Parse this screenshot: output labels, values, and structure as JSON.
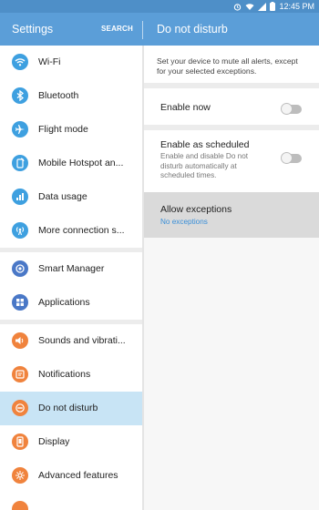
{
  "status_bar": {
    "time": "12:45 PM"
  },
  "app_bar": {
    "left_title": "Settings",
    "search_label": "SEARCH",
    "right_title": "Do not disturb"
  },
  "sidebar": {
    "groups": [
      [
        {
          "label": "Wi-Fi",
          "icon": "wifi-icon",
          "color": "#3ea0e0"
        },
        {
          "label": "Bluetooth",
          "icon": "bluetooth-icon",
          "color": "#3ea0e0"
        },
        {
          "label": "Flight mode",
          "icon": "airplane-icon",
          "color": "#3ea0e0"
        },
        {
          "label": "Mobile Hotspot an...",
          "icon": "hotspot-icon",
          "color": "#3ea0e0"
        },
        {
          "label": "Data usage",
          "icon": "data-usage-icon",
          "color": "#3ea0e0"
        },
        {
          "label": "More connection s...",
          "icon": "more-connections-icon",
          "color": "#3ea0e0"
        }
      ],
      [
        {
          "label": "Smart Manager",
          "icon": "smart-manager-icon",
          "color": "#4a78c7"
        },
        {
          "label": "Applications",
          "icon": "applications-icon",
          "color": "#4a78c7"
        }
      ],
      [
        {
          "label": "Sounds and vibrati...",
          "icon": "sound-icon",
          "color": "#f0833d"
        },
        {
          "label": "Notifications",
          "icon": "notifications-icon",
          "color": "#f0833d"
        },
        {
          "label": "Do not disturb",
          "icon": "do-not-disturb-icon",
          "color": "#f0833d",
          "selected": true
        },
        {
          "label": "Display",
          "icon": "display-icon",
          "color": "#f0833d"
        },
        {
          "label": "Advanced features",
          "icon": "advanced-features-icon",
          "color": "#f0833d"
        }
      ]
    ]
  },
  "detail": {
    "description": "Set your device to mute all alerts, except for your selected exceptions.",
    "enable_now": {
      "label": "Enable now",
      "state": "off"
    },
    "enable_scheduled": {
      "label": "Enable as scheduled",
      "sub": "Enable and disable Do not disturb automatically at scheduled times.",
      "state": "off"
    },
    "exceptions": {
      "label": "Allow exceptions",
      "sub": "No exceptions"
    }
  }
}
